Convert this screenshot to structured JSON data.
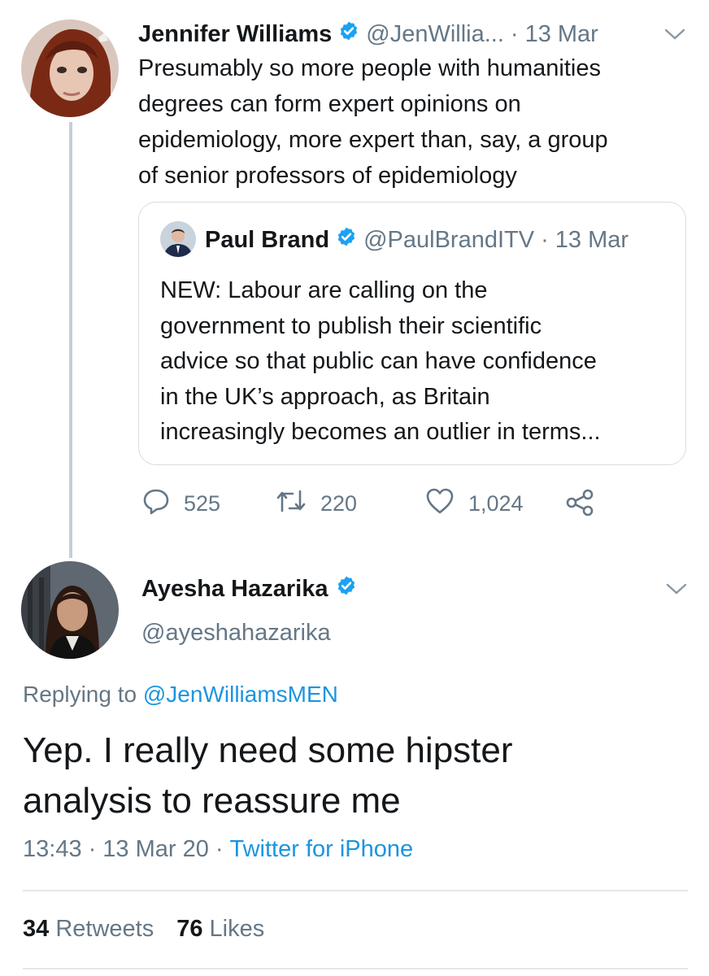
{
  "tweet": {
    "author_name": "Jennifer Williams",
    "author_handle": "@JenWillia...",
    "date": "13 Mar",
    "separator": "·",
    "text_lines": [
      "Presumably so more people with humanities",
      "degrees can form expert opinions on",
      "epidemiology, more expert than, say, a group",
      "of senior professors of epidemiology"
    ],
    "quote": {
      "author_name": "Paul Brand",
      "author_handle": "@PaulBrandITV",
      "date": "13 Mar",
      "text_lines": [
        "NEW: Labour are calling on the",
        "government to publish their scientific",
        "advice so that public can have confidence",
        "in the UK’s approach, as Britain",
        "increasingly becomes an outlier in terms..."
      ]
    },
    "actions": {
      "replies": "525",
      "retweets": "220",
      "likes": "1,024"
    }
  },
  "reply": {
    "author_name": "Ayesha Hazarika",
    "author_handle": "@ayeshahazarika",
    "replying_to_label": "Replying to",
    "replying_to_handle": "@JenWilliamsMEN",
    "text_lines": [
      "Yep. I really need some hipster",
      "analysis to reassure me"
    ],
    "time": "13:43",
    "date": "13 Mar 20",
    "separator": "·",
    "source": "Twitter for iPhone",
    "retweet_count": "34",
    "retweet_label": "Retweets",
    "like_count": "76",
    "like_label": "Likes"
  },
  "colors": {
    "text": "#14171a",
    "muted": "#657786",
    "link": "#1b95e0",
    "verified": "#1da1f2",
    "border": "#e1e8ed"
  },
  "icons": [
    "verified-badge-icon",
    "chevron-down-icon",
    "reply-icon",
    "retweet-icon",
    "like-icon",
    "share-icon"
  ]
}
